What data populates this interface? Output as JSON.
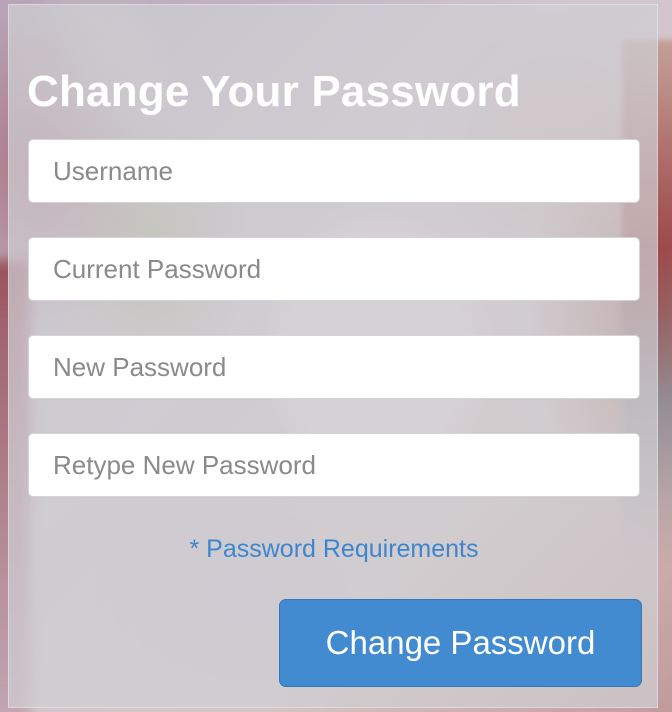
{
  "form": {
    "title": "Change Your Password",
    "fields": [
      {
        "placeholder": "Username",
        "value": ""
      },
      {
        "placeholder": "Current Password",
        "value": ""
      },
      {
        "placeholder": "New Password",
        "value": ""
      },
      {
        "placeholder": "Retype New Password",
        "value": ""
      }
    ],
    "requirements_link": "* Password Requirements",
    "submit_label": "Change Password"
  },
  "colors": {
    "accent": "#428bd0",
    "link": "#3d86cf",
    "title_text": "#ffffff",
    "card_overlay": "#cecfd2"
  }
}
